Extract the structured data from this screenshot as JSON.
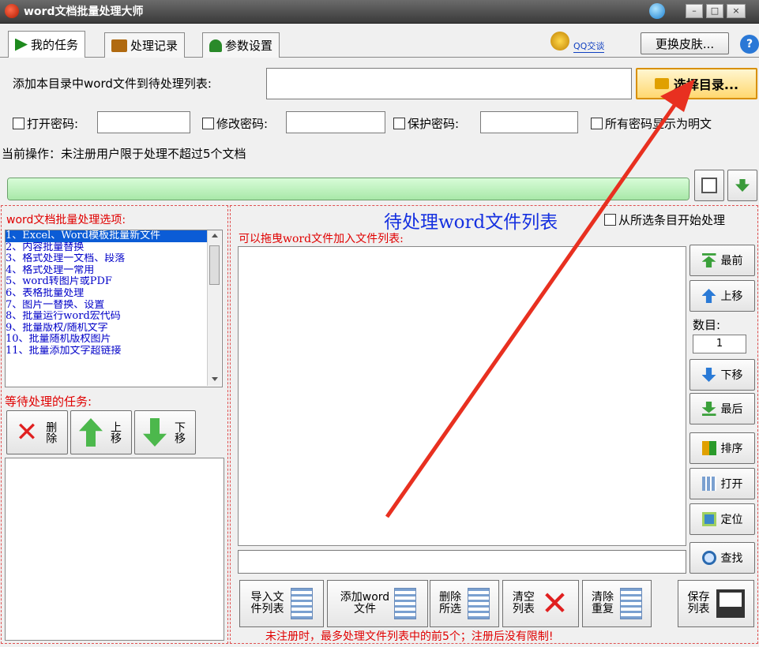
{
  "window": {
    "title": "word文档批量处理大师",
    "min": "–",
    "max": "□",
    "close": "×"
  },
  "tabs": [
    "我的任务",
    "处理记录",
    "参数设置"
  ],
  "toolbar": {
    "qq_label": "QQ交谈",
    "skin_button": "更换皮肤...",
    "help": "?"
  },
  "add_dir": {
    "label": "添加本目录中word文件到待处理列表:",
    "value": "",
    "button": "选择目录..."
  },
  "passwords": {
    "open_label": "打开密码:",
    "modify_label": "修改密码:",
    "protect_label": "保护密码:",
    "show_plain_label": "所有密码显示为明文"
  },
  "status": {
    "text": "当前操作：未注册用户限于处理不超过5个文档",
    "progress": 1.0
  },
  "options": {
    "title": "word文档批量处理选项:",
    "items": [
      "1、Excel、Word模板批量新文件",
      "2、内容批量替换",
      "3、格式处理一文档、段落",
      "4、格式处理一常用",
      "5、word转图片或PDF",
      "6、表格批量处理",
      "7、图片一替换、设置",
      "8、批量运行word宏代码",
      "9、批量版权/随机文字",
      "10、批量随机版权图片",
      "11、批量添加文字超链接"
    ],
    "selected_index": 0
  },
  "pending": {
    "title": "等待处理的任务:",
    "delete": "删除",
    "up": "上移",
    "down": "下移"
  },
  "filelist": {
    "title": "待处理word文件列表",
    "from_selected": "从所选条目开始处理",
    "hint": "可以拖曳word文件加入文件列表:",
    "search_value": ""
  },
  "side": {
    "first": "最前",
    "up": "上移",
    "count_label": "数目:",
    "count_value": "1",
    "down": "下移",
    "last": "最后",
    "sort": "排序",
    "open": "打开",
    "locate": "定位",
    "find": "查找"
  },
  "bottom": {
    "import": "导入文件列表",
    "add": "添加word文件",
    "delete_sel": "删除所选",
    "clear": "清空列表",
    "dedupe": "清除重复",
    "save": "保存列表",
    "notice": "未注册时，最多处理文件列表中的前5个；注册后没有限制!"
  },
  "colors": {
    "accent": "#e00000",
    "selected": "#0b5cd6",
    "progress": "#b8f0b8",
    "arrow": "#e83020"
  }
}
